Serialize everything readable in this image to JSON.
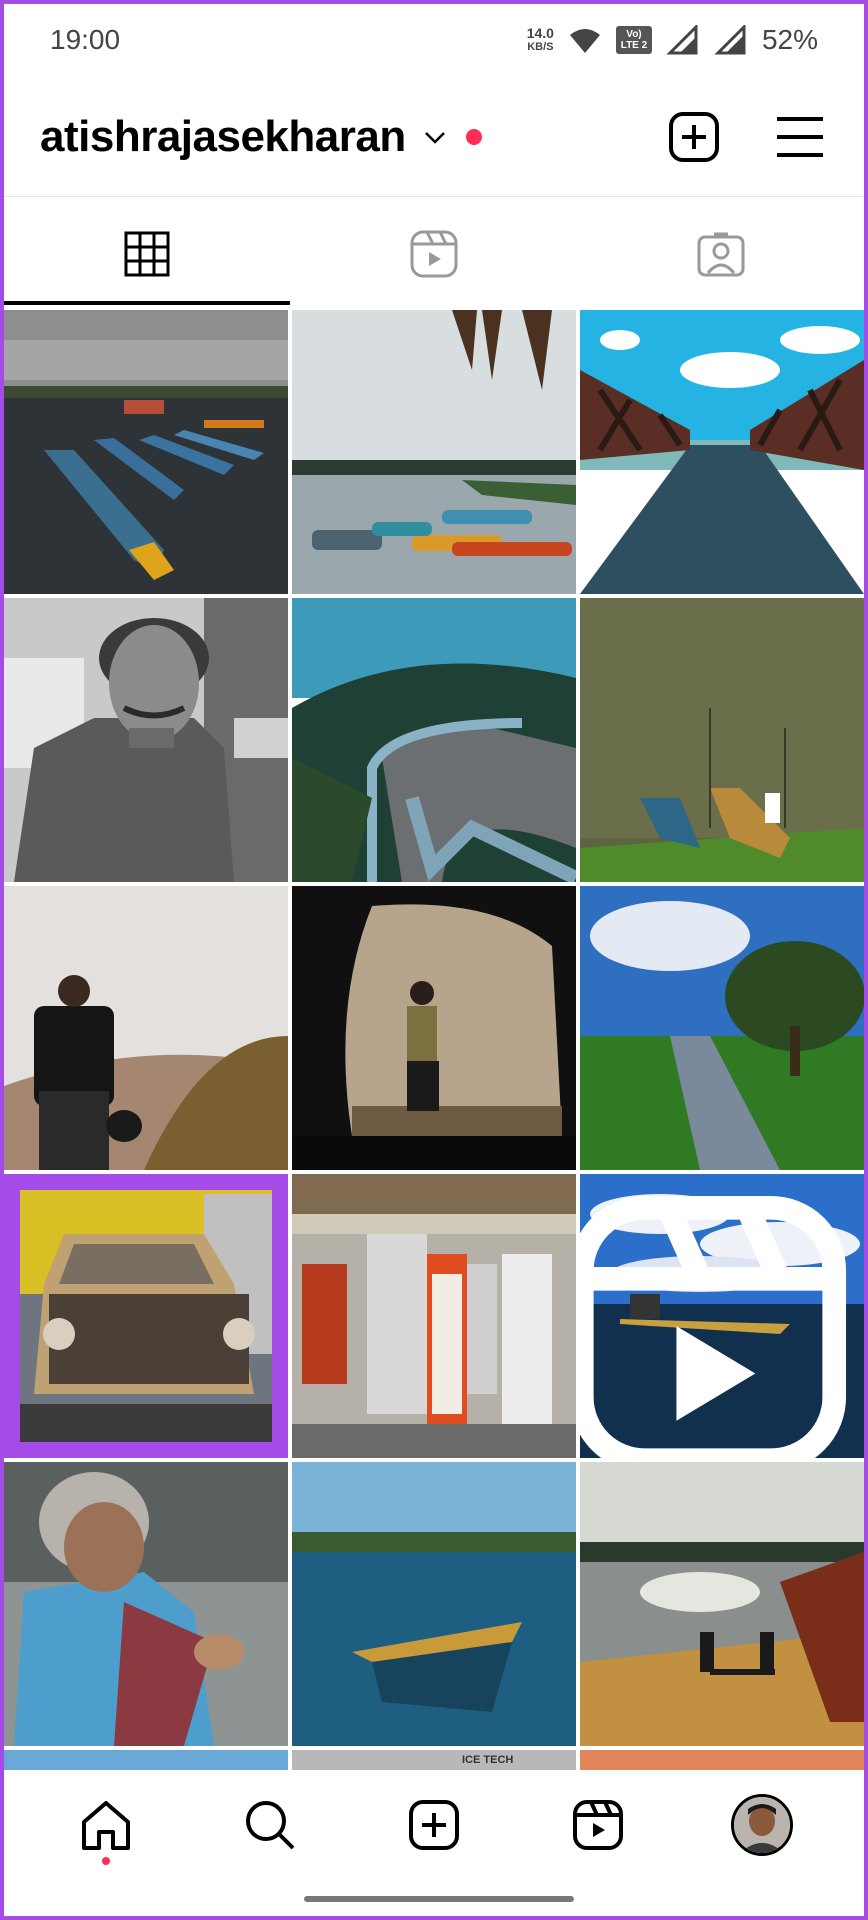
{
  "status_bar": {
    "time": "19:00",
    "net_speed_value": "14.0",
    "net_speed_unit": "KB/S",
    "lte_top": "Vo)",
    "lte_bottom": "LTE 2",
    "battery": "52%"
  },
  "header": {
    "username": "atishrajasekharan",
    "icons": [
      "chevron-down-icon",
      "notification-dot",
      "add-post-icon",
      "menu-icon"
    ]
  },
  "tabs": [
    {
      "name": "posts-grid",
      "icon": "grid-icon",
      "active": true
    },
    {
      "name": "reels",
      "icon": "reels-icon",
      "active": false
    },
    {
      "name": "tagged",
      "icon": "tagged-person-icon",
      "active": false
    }
  ],
  "grid": {
    "tiles": [
      {
        "subject": "boats-on-lake"
      },
      {
        "subject": "boats-under-palm"
      },
      {
        "subject": "wooden-bridge"
      },
      {
        "subject": "portrait-man"
      },
      {
        "subject": "mountain-road"
      },
      {
        "subject": "fisherman-boats"
      },
      {
        "subject": "man-in-fog"
      },
      {
        "subject": "man-in-cave"
      },
      {
        "subject": "river-tree"
      },
      {
        "subject": "old-car",
        "selected": true
      },
      {
        "subject": "street-crowd"
      },
      {
        "subject": "boat-at-sea",
        "reel": true
      },
      {
        "subject": "old-woman"
      },
      {
        "subject": "boat-on-river"
      },
      {
        "subject": "beach-silhouettes"
      }
    ],
    "partial_text": "ICE TECH"
  },
  "bottom_nav": [
    {
      "name": "home",
      "icon": "home-icon",
      "active": true
    },
    {
      "name": "search",
      "icon": "search-icon"
    },
    {
      "name": "create",
      "icon": "add-post-icon"
    },
    {
      "name": "reels",
      "icon": "reels-icon"
    },
    {
      "name": "profile",
      "icon": "profile-avatar"
    }
  ],
  "colors": {
    "accent_border": "#a44be8",
    "notification": "#ff2d55"
  }
}
